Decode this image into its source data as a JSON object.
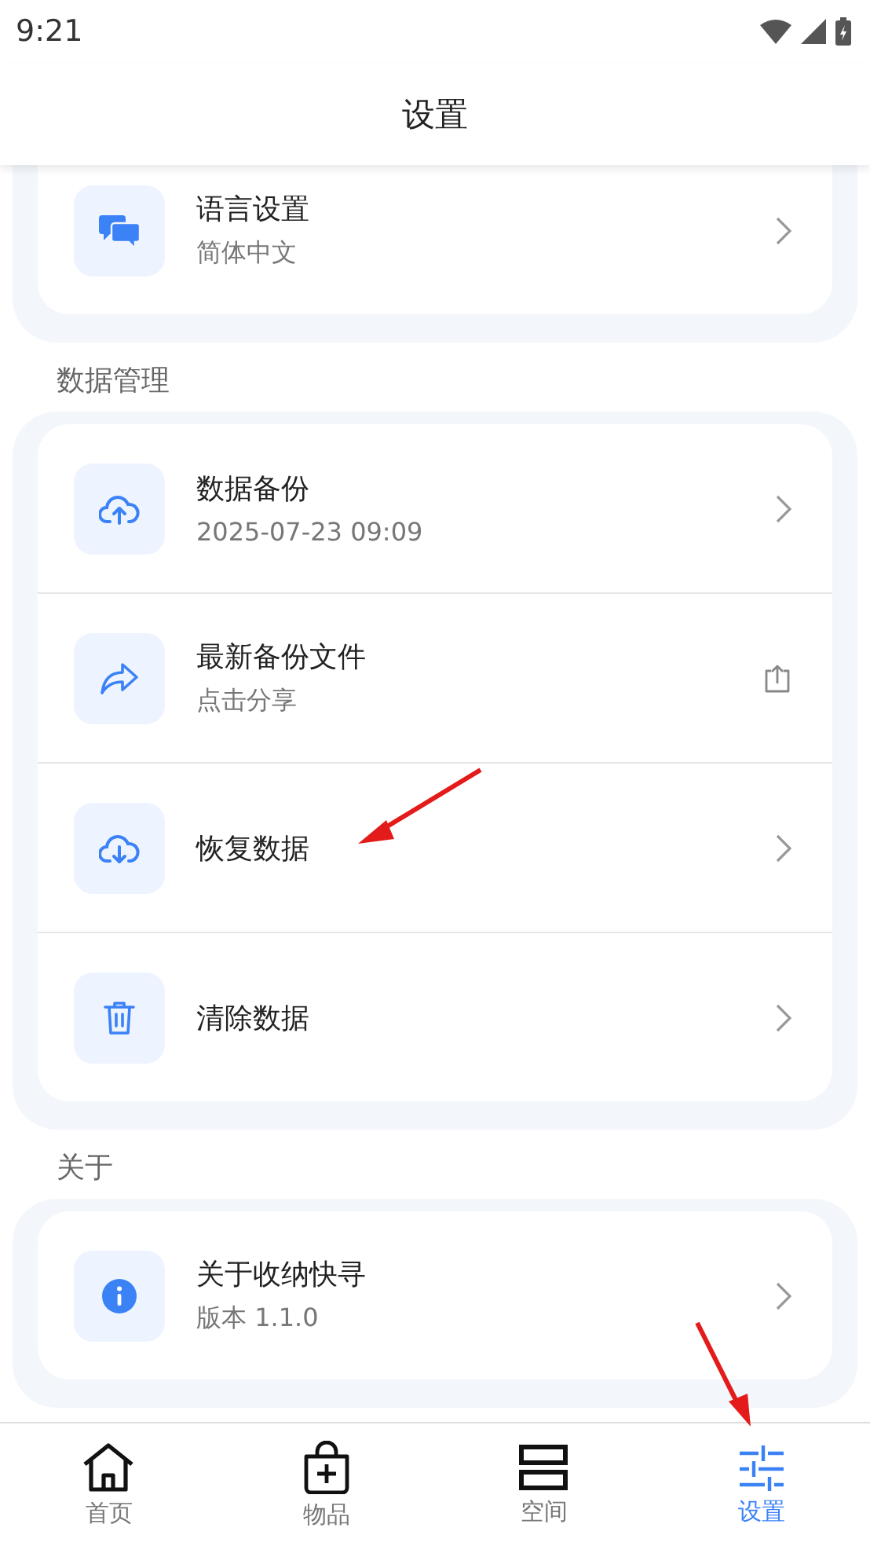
{
  "status_bar": {
    "time": "9:21"
  },
  "header": {
    "title": "设置"
  },
  "sections": [
    {
      "items": [
        {
          "title": "语言设置",
          "subtitle": "简体中文",
          "kind": "chevron"
        }
      ]
    },
    {
      "label": "数据管理",
      "items": [
        {
          "title": "数据备份",
          "subtitle": "2025-07-23 09:09",
          "kind": "chevron"
        },
        {
          "title": "最新备份文件",
          "subtitle": "点击分享",
          "kind": "share"
        },
        {
          "title": "恢复数据",
          "kind": "chevron"
        },
        {
          "title": "清除数据",
          "kind": "chevron"
        }
      ]
    },
    {
      "label": "关于",
      "items": [
        {
          "title": "关于收纳快寻",
          "subtitle": "版本 1.1.0",
          "kind": "chevron"
        }
      ]
    }
  ],
  "tabs": [
    {
      "label": "首页",
      "selected": false
    },
    {
      "label": "物品",
      "selected": false
    },
    {
      "label": "空间",
      "selected": false
    },
    {
      "label": "设置",
      "selected": true
    }
  ]
}
